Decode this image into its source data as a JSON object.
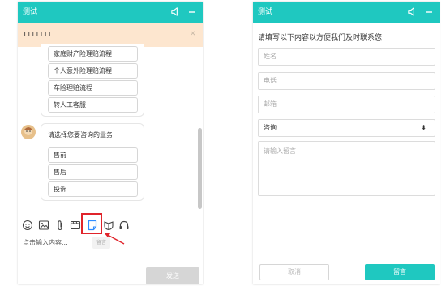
{
  "colors": {
    "accent": "#1fc8c0",
    "notice_bg": "#fde6cf",
    "arrow": "#e0242b",
    "highlight": "#2f8cff"
  },
  "chat_window": {
    "title": "测试",
    "notice": {
      "text": "1111111",
      "close_icon": "×"
    },
    "messages": [
      {
        "options": [
          "家庭财产险理赔流程",
          "个人意外险理赔流程",
          "车险理赔流程",
          "转人工客服"
        ]
      },
      {
        "prompt": "请选择您要咨询的业务",
        "options": [
          "售前",
          "售后",
          "投诉"
        ]
      }
    ],
    "toolbar": {
      "icons": [
        "emoji-icon",
        "image-icon",
        "attachment-icon",
        "video-icon",
        "message-board-icon",
        "evaluate-icon",
        "headset-icon"
      ],
      "tooltip": "留言"
    },
    "input_placeholder": "点击输入内容...",
    "send_label": "发送"
  },
  "message_form": {
    "title": "测试",
    "heading": "请填写以下内容以方便我们及时联系您",
    "name_placeholder": "姓名",
    "phone_placeholder": "电话",
    "email_placeholder": "邮箱",
    "type_selected": "咨询",
    "type_caret": "⬍",
    "message_placeholder": "请输入留言",
    "cancel_label": "取消",
    "submit_label": "留言"
  }
}
